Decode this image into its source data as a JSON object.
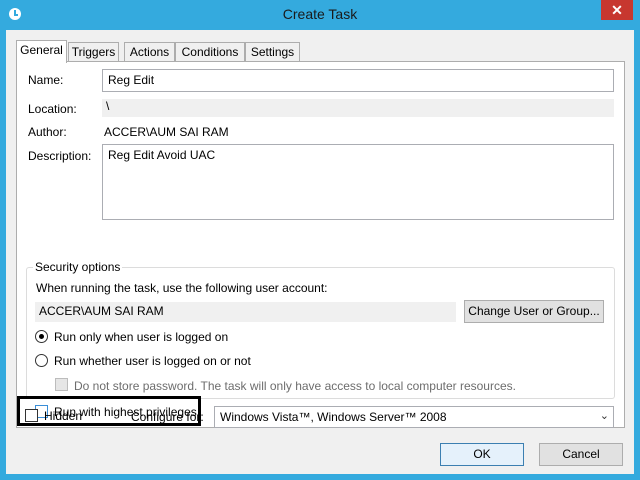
{
  "window": {
    "title": "Create Task",
    "close_glyph": "✕",
    "accent": "#34aade"
  },
  "tabs": [
    {
      "label": "General"
    },
    {
      "label": "Triggers"
    },
    {
      "label": "Actions"
    },
    {
      "label": "Conditions"
    },
    {
      "label": "Settings"
    }
  ],
  "general": {
    "name_label": "Name:",
    "name_value": "Reg Edit",
    "location_label": "Location:",
    "location_value": "\\",
    "author_label": "Author:",
    "author_value": "ACCER\\AUM SAI RAM",
    "description_label": "Description:",
    "description_value": "Reg Edit Avoid UAC"
  },
  "security": {
    "group_title": "Security options",
    "account_prompt": "When running the task, use the following user account:",
    "account_value": "ACCER\\AUM SAI RAM",
    "change_button": "Change User or Group...",
    "radio_logged_on": "Run only when user is logged on",
    "radio_logged_on_or_not": "Run whether user is logged on or not",
    "no_store_password": "Do not store password.  The task will only have access to local computer resources.",
    "highest_privileges": "Run with highest privileges"
  },
  "footer": {
    "hidden_label": "Hidden",
    "configure_label": "Configure for:",
    "configure_value": "Windows Vista™, Windows Server™ 2008"
  },
  "buttons": {
    "ok": "OK",
    "cancel": "Cancel"
  }
}
